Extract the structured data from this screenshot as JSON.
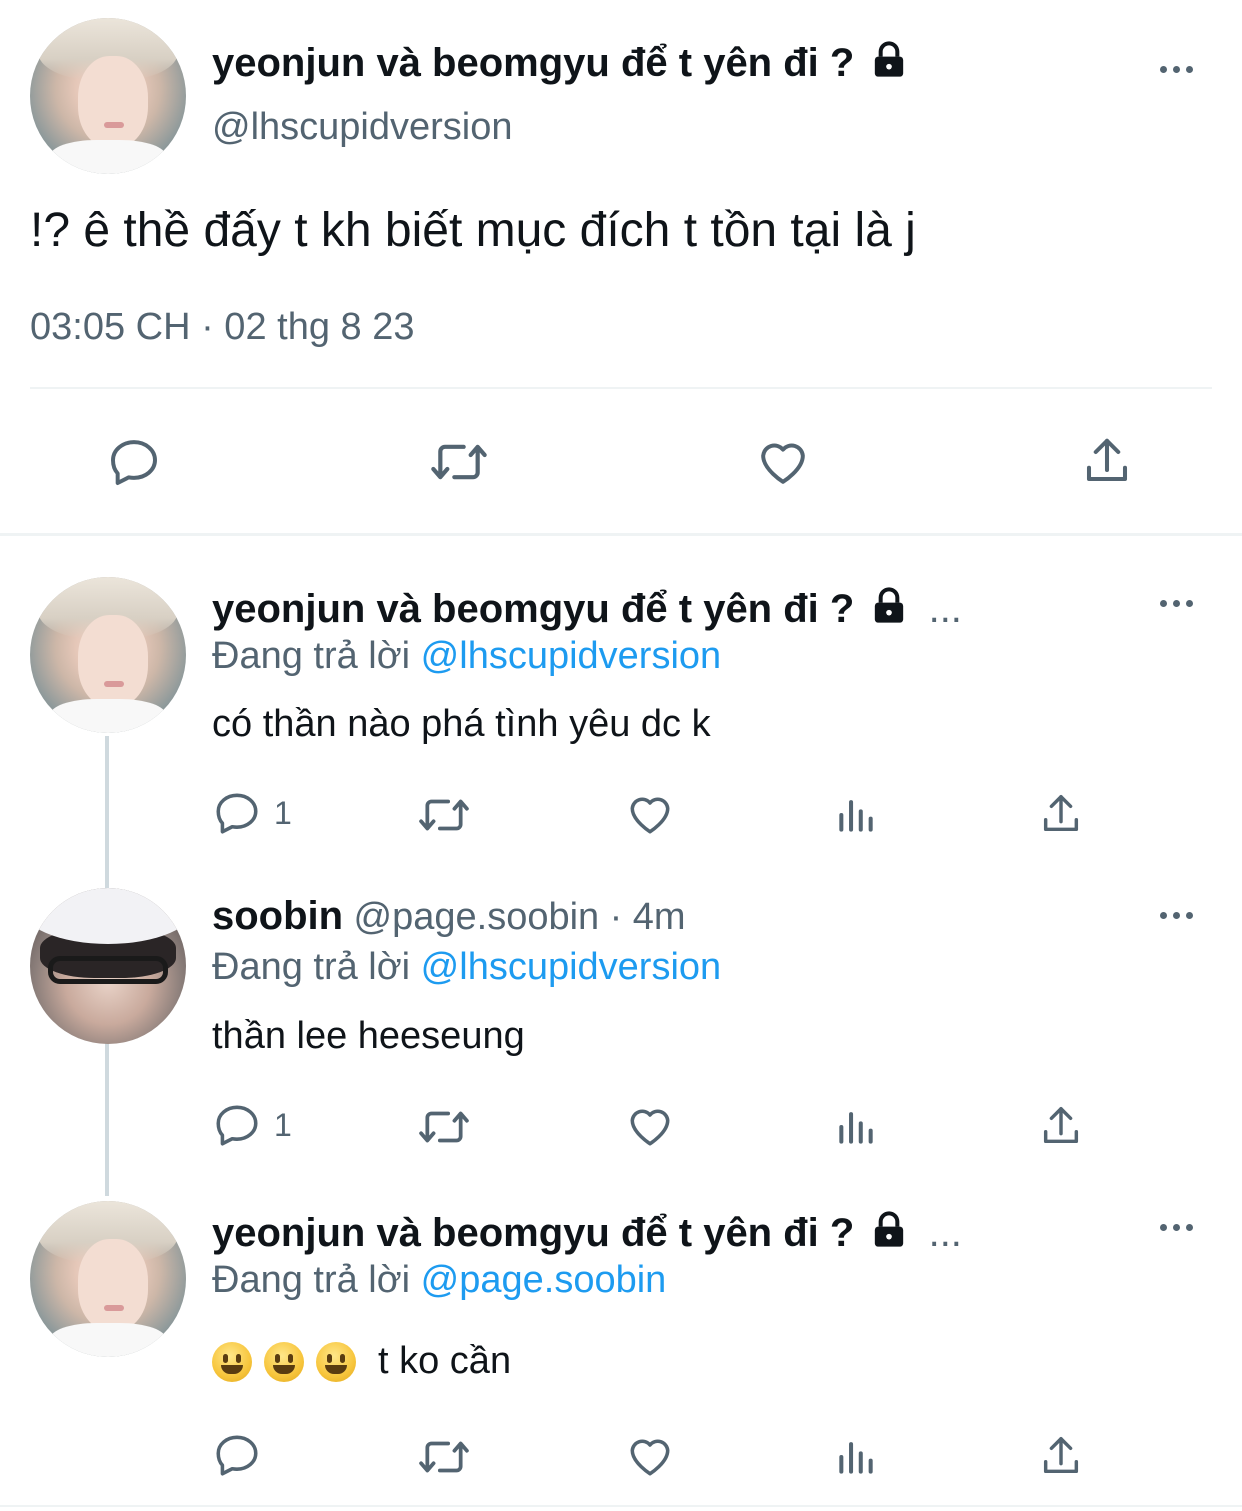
{
  "main_tweet": {
    "display_name": "yeonjun và beomgyu để t yên đi ?",
    "handle": "@lhscupidversion",
    "text": "!? ê thề đấy t kh biết mục đích t tồn tại là j",
    "timestamp": "03:05 CH · 02 thg 8 23",
    "locked": true
  },
  "replies": [
    {
      "display_name": "yeonjun và beomgyu để t yên đi ?",
      "ellipsis": "...",
      "replying_label": "Đang trả lời",
      "replying_to": "@lhscupidversion",
      "text": "có thần nào phá tình yêu dc k",
      "reply_count": "1"
    },
    {
      "display_name": "soobin",
      "handle": "@page.soobin",
      "separator": "·",
      "time_ago": "4m",
      "replying_label": "Đang trả lời",
      "replying_to": "@lhscupidversion",
      "text": "thần lee heeseung",
      "reply_count": "1"
    },
    {
      "display_name": "yeonjun và beomgyu để t yên đi ?",
      "ellipsis": "...",
      "replying_label": "Đang trả lời",
      "replying_to": "@page.soobin",
      "emoji": [
        "grinning-face",
        "grinning-face",
        "grinning-face"
      ],
      "text": "t ko cần"
    }
  ],
  "colors": {
    "text": "#0f1419",
    "secondary": "#536471",
    "link": "#1d9bf0",
    "divider": "#eff3f4",
    "thread_line": "#cfd9de"
  }
}
